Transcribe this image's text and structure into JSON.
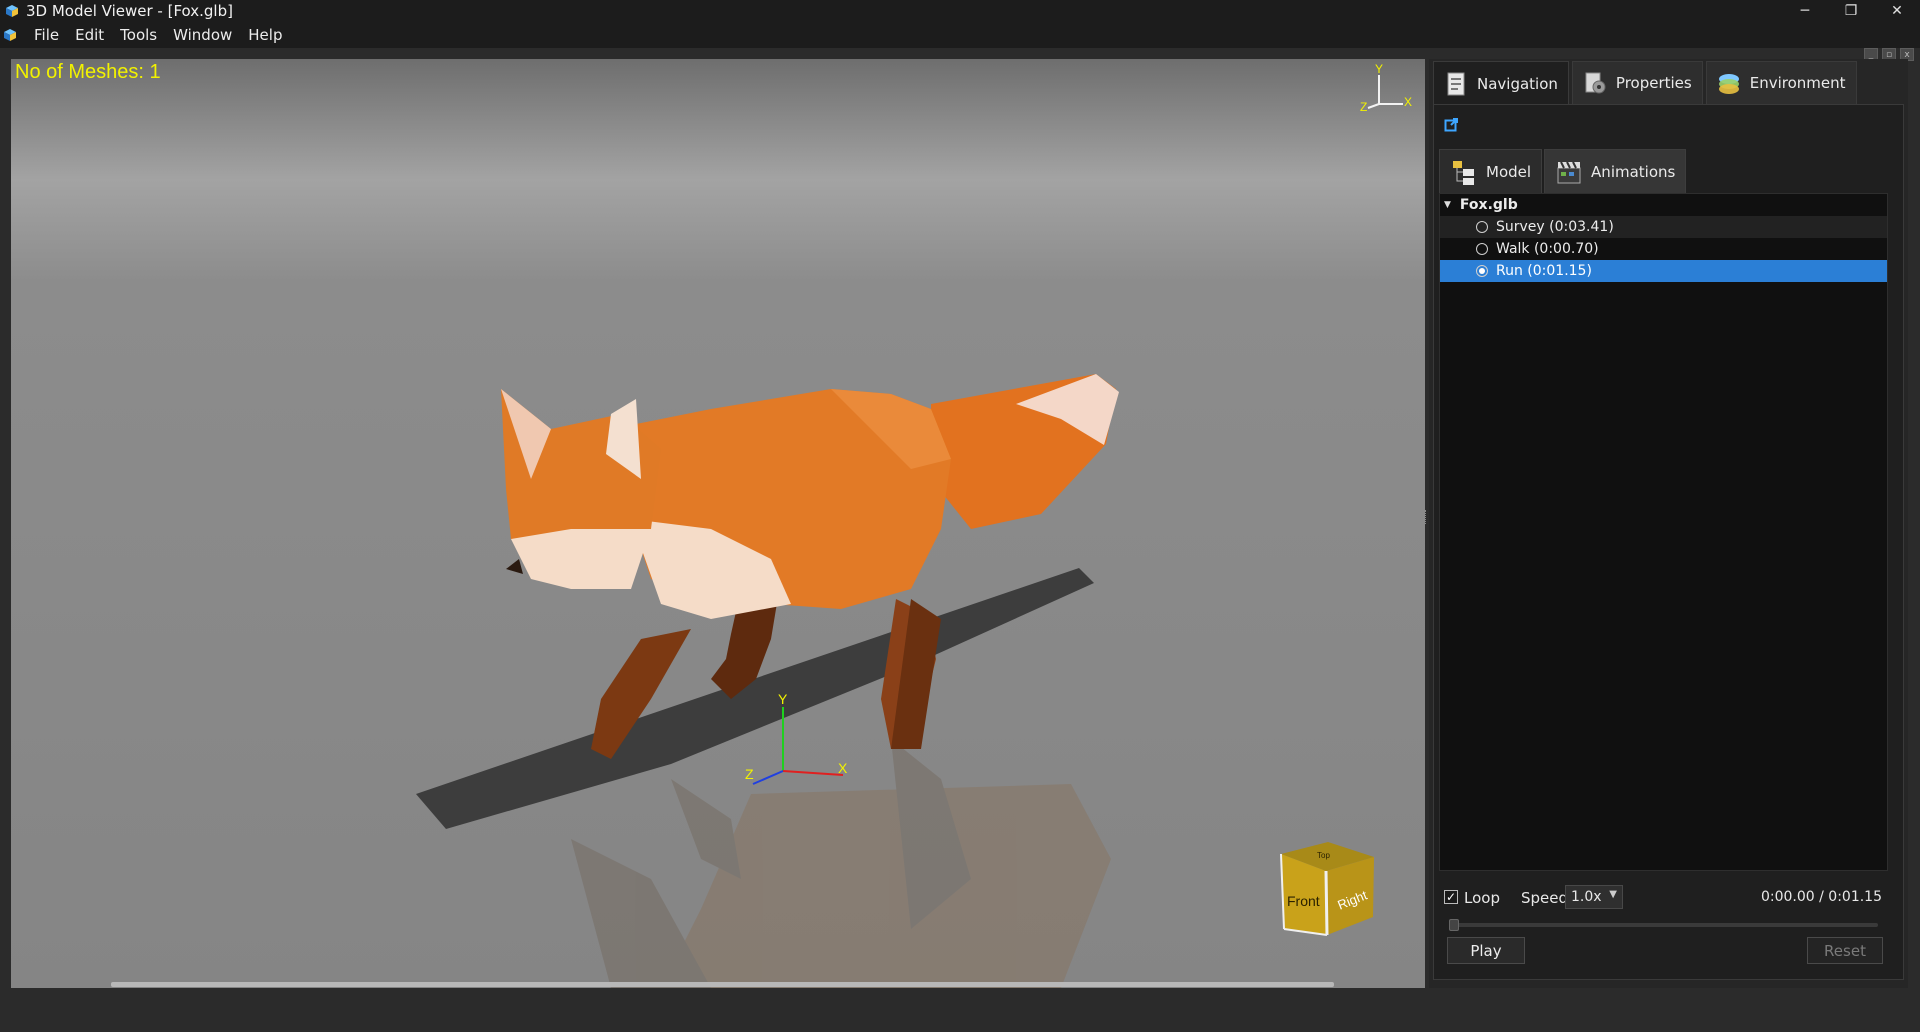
{
  "window": {
    "title": "3D Model Viewer - [Fox.glb]",
    "controls": {
      "minimize": "─",
      "restore": "❐",
      "close": "✕"
    }
  },
  "menu": {
    "items": [
      "File",
      "Edit",
      "Tools",
      "Window",
      "Help"
    ]
  },
  "viewport": {
    "mesh_count_label": "No of Meshes: 1",
    "axis_gizmo": {
      "y": "Y",
      "x": "X",
      "z": "Z"
    },
    "view_cube": {
      "front": "Front",
      "right": "Right",
      "top": "Top"
    },
    "background_color": "#8f8f8f"
  },
  "panel": {
    "tabs": [
      {
        "label": "Navigation",
        "icon": "navigation-document-icon"
      },
      {
        "label": "Properties",
        "icon": "properties-gear-icon"
      },
      {
        "label": "Environment",
        "icon": "environment-layers-icon"
      }
    ],
    "subtabs": [
      {
        "label": "Model",
        "icon": "model-tree-icon"
      },
      {
        "label": "Animations",
        "icon": "clapperboard-icon"
      }
    ],
    "tree": {
      "root": "Fox.glb",
      "animations": [
        {
          "label": "Survey (0:03.41)",
          "selected": false
        },
        {
          "label": "Walk (0:00.70)",
          "selected": false
        },
        {
          "label": "Run (0:01.15)",
          "selected": true
        }
      ]
    },
    "playback": {
      "loop_label": "Loop",
      "loop_checked": "✓",
      "speed_label": "Speed",
      "speed_value": "1.0x",
      "time": "0:00.00 / 0:01.15",
      "play_label": "Play",
      "reset_label": "Reset"
    }
  },
  "colors": {
    "selection": "#2b7fd6",
    "mesh_count_text": "#f2f200",
    "fox_orange": "#e07a25"
  }
}
